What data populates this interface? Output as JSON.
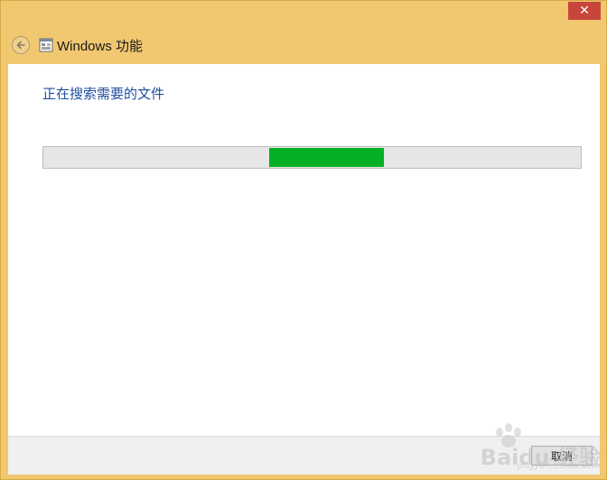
{
  "window": {
    "title": "Windows 功能",
    "close_glyph": "✕",
    "back_glyph": "←"
  },
  "content": {
    "status_text": "正在搜索需要的文件"
  },
  "footer": {
    "cancel_label": "取消"
  },
  "watermark": {
    "text": "Baidu 经验",
    "url": "jingyan.baidu.com"
  },
  "colors": {
    "frame": "#f1c86f",
    "status_text": "#1f4fa0",
    "progress_fill": "#06b025",
    "close_button": "#c7463b"
  },
  "icons": {
    "back": "back-arrow-icon",
    "app": "windows-features-icon",
    "close": "close-icon"
  }
}
